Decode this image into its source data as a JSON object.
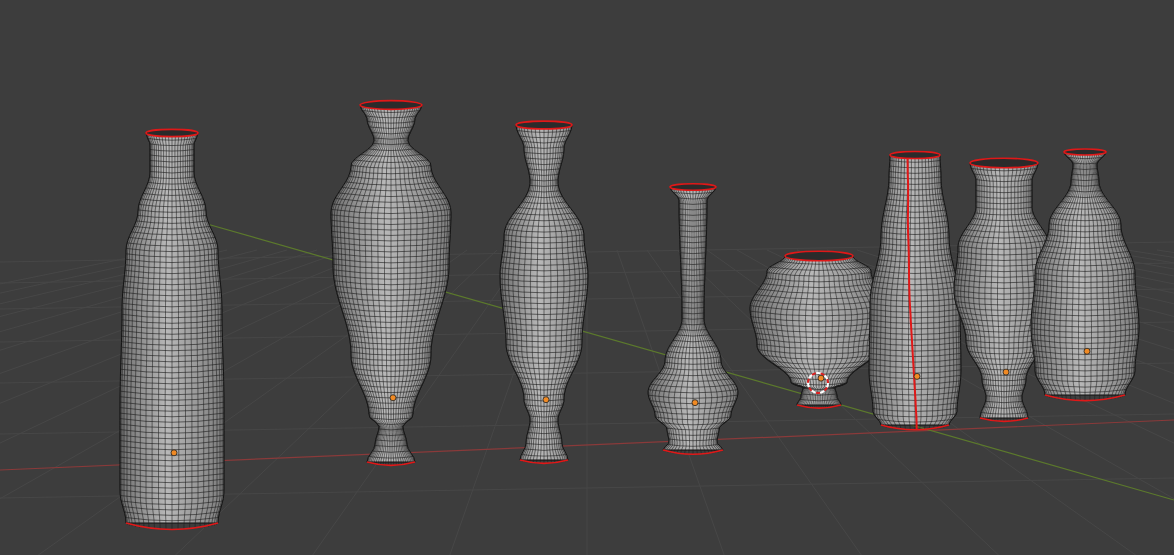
{
  "viewport": {
    "objects": [
      {
        "kind": "bottle"
      },
      {
        "kind": "amphora"
      },
      {
        "kind": "baluster"
      },
      {
        "kind": "bud"
      },
      {
        "kind": "pot"
      },
      {
        "kind": "seamed"
      },
      {
        "kind": "urn"
      },
      {
        "kind": "gourd"
      }
    ]
  }
}
